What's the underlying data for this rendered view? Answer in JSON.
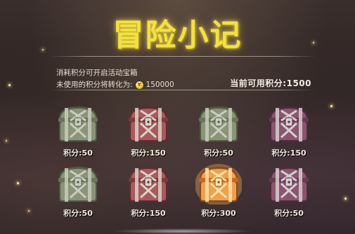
{
  "title": "冒险小记",
  "info": {
    "line1": "消耗积分可开启活动宝箱",
    "line2_prefix": "未使用的积分将转化为:",
    "coin_amount": "150000"
  },
  "current_points": "当前可用积分:1500",
  "chests": [
    {
      "label": "积分:50",
      "theme": "green",
      "selected": false
    },
    {
      "label": "积分:150",
      "theme": "red",
      "selected": false
    },
    {
      "label": "积分:50",
      "theme": "green",
      "selected": false
    },
    {
      "label": "积分:150",
      "theme": "purple",
      "selected": false
    },
    {
      "label": "积分:50",
      "theme": "green",
      "selected": false
    },
    {
      "label": "积分:150",
      "theme": "red",
      "selected": false
    },
    {
      "label": "积分:300",
      "theme": "gold",
      "selected": true
    },
    {
      "label": "积分:50",
      "theme": "purple",
      "selected": false
    }
  ],
  "colors": {
    "title": "#f4e23a",
    "green": "#7d8a6a",
    "red": "#9a4a4c",
    "purple": "#7c4a66",
    "gold": "#e0892e"
  }
}
